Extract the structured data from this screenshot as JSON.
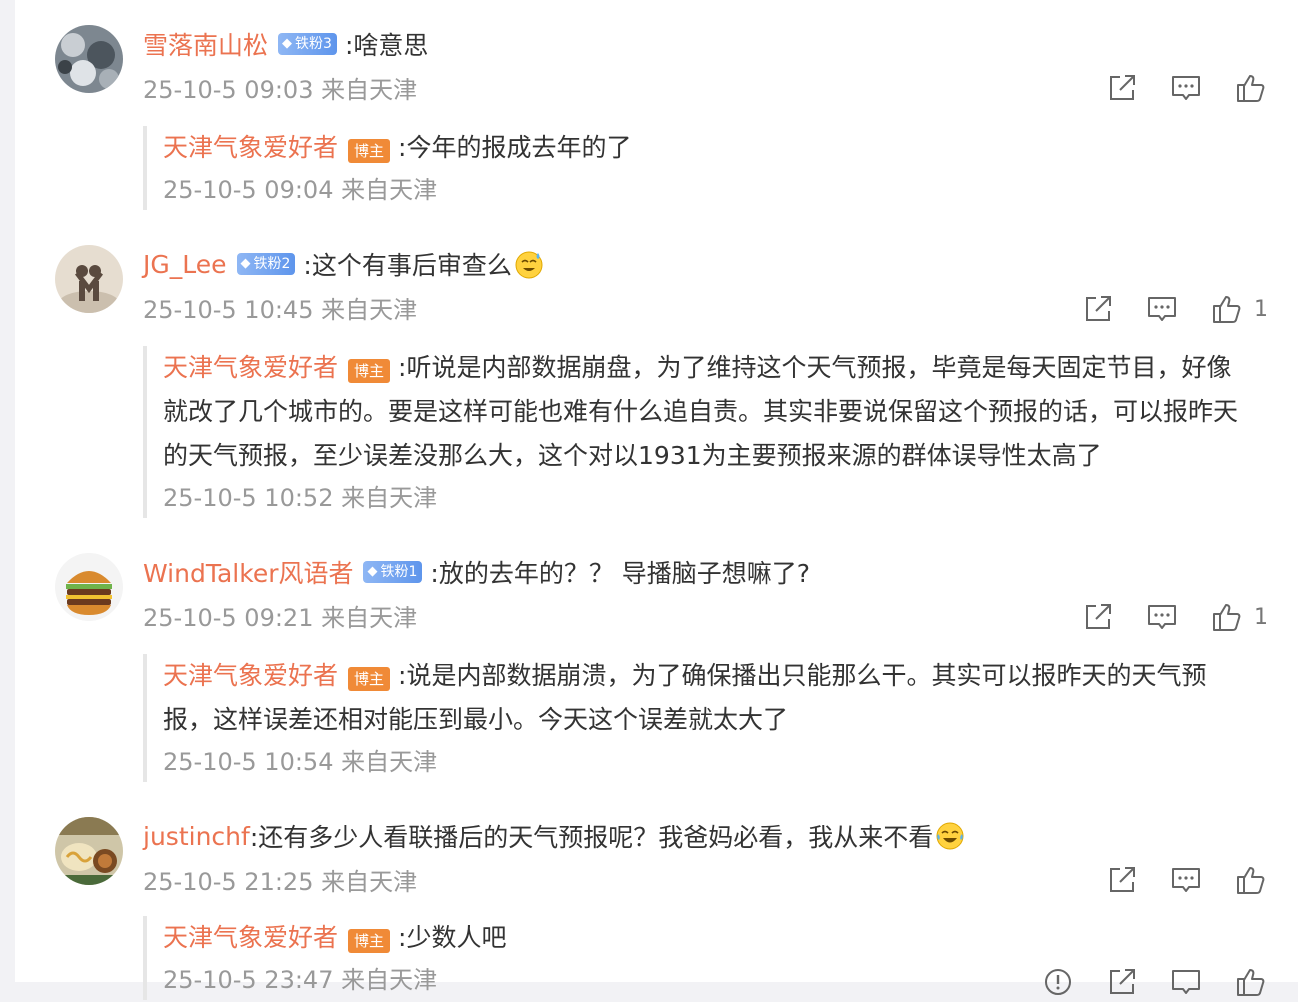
{
  "comments": [
    {
      "user": "雪落南山松",
      "fan_badge": "铁粉3",
      "text": ":啥意思",
      "meta": "25-10-5 09:03 来自天津",
      "likes": "",
      "reply": {
        "user": "天津气象爱好者",
        "badge": "博主",
        "text": ":今年的报成去年的了",
        "meta": "25-10-5 09:04 来自天津"
      }
    },
    {
      "user": "JG_Lee",
      "fan_badge": "铁粉2",
      "text": ":这个有事后审查么",
      "meta": "25-10-5 10:45 来自天津",
      "likes": "1",
      "reply": {
        "user": "天津气象爱好者",
        "badge": "博主",
        "text": ":听说是内部数据崩盘，为了维持这个天气预报，毕竟是每天固定节目，好像就改了几个城市的。要是这样可能也难有什么追自责。其实非要说保留这个预报的话，可以报昨天的天气预报，至少误差没那么大，这个对以1931为主要预报来源的群体误导性太高了",
        "meta": "25-10-5 10:52 来自天津"
      }
    },
    {
      "user": "WindTalker风语者",
      "fan_badge": "铁粉1",
      "text": ":放的去年的？？ 导播脑子想嘛了?",
      "meta": "25-10-5 09:21 来自天津",
      "likes": "1",
      "reply": {
        "user": "天津气象爱好者",
        "badge": "博主",
        "text": ":说是内部数据崩溃，为了确保播出只能那么干。其实可以报昨天的天气预报，这样误差还相对能压到最小。今天这个误差就太大了",
        "meta": "25-10-5 10:54 来自天津"
      }
    },
    {
      "user": "justinchf",
      "fan_badge": "",
      "text": ":还有多少人看联播后的天气预报呢？我爸妈必看，我从来不看",
      "meta": "25-10-5 21:25 来自天津",
      "likes": "",
      "reply": {
        "user": "天津气象爱好者",
        "badge": "博主",
        "text": ":少数人吧",
        "meta": "25-10-5 23:47 来自天津"
      }
    }
  ],
  "icons": {
    "share": "share-icon",
    "comment": "comment-icon",
    "like": "thumbs-up-icon",
    "emoji_sweat": "sweat-smile-emoji",
    "emoji_laugh": "laugh-cry-emoji"
  },
  "colors": {
    "username": "#eb7350",
    "host_badge": "#f08a37",
    "fan_badge": "#6a9ff0",
    "meta": "#999999",
    "background": "#f2f2f5"
  }
}
